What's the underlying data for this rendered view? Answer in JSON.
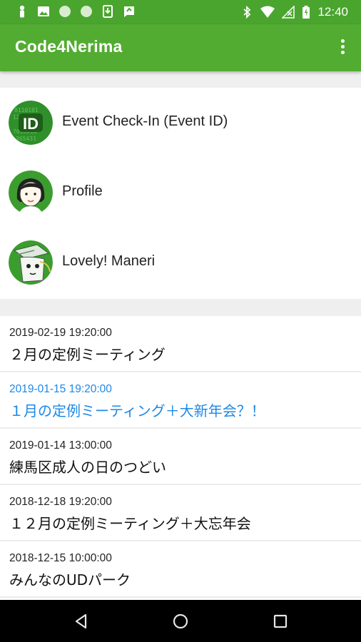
{
  "status_bar": {
    "time": "12:40",
    "left_icons": [
      "person-icon",
      "image-icon",
      "circle-icon",
      "circle-icon",
      "download-icon",
      "feedback-icon"
    ],
    "right_icons": [
      "bluetooth-icon",
      "wifi-icon",
      "no-signal-icon",
      "battery-icon"
    ]
  },
  "app_bar": {
    "title": "Code4Nerima",
    "overflow_icon": "more-vert-icon"
  },
  "menu": [
    {
      "label": "Event Check-In (Event ID)",
      "icon": "id-icon"
    },
    {
      "label": "Profile",
      "icon": "profile-avatar-icon"
    },
    {
      "label": "Lovely! Maneri",
      "icon": "maneri-icon"
    }
  ],
  "events": [
    {
      "date": "2019-02-19 19:20:00",
      "title": "２月の定例ミーティング",
      "active": false
    },
    {
      "date": "2019-01-15 19:20:00",
      "title": "１月の定例ミーティング＋大新年会？！",
      "active": true
    },
    {
      "date": "2019-01-14 13:00:00",
      "title": "練馬区成人の日のつどい",
      "active": false
    },
    {
      "date": "2018-12-18 19:20:00",
      "title": "１２月の定例ミーティング＋大忘年会",
      "active": false
    },
    {
      "date": "2018-12-15 10:00:00",
      "title": "みんなのUDパーク",
      "active": false
    }
  ],
  "colors": {
    "status_bar": "#4aa52e",
    "app_bar": "#52ac31",
    "active_link": "#1e88e5"
  },
  "nav": [
    "back-icon",
    "home-icon",
    "recents-icon"
  ]
}
